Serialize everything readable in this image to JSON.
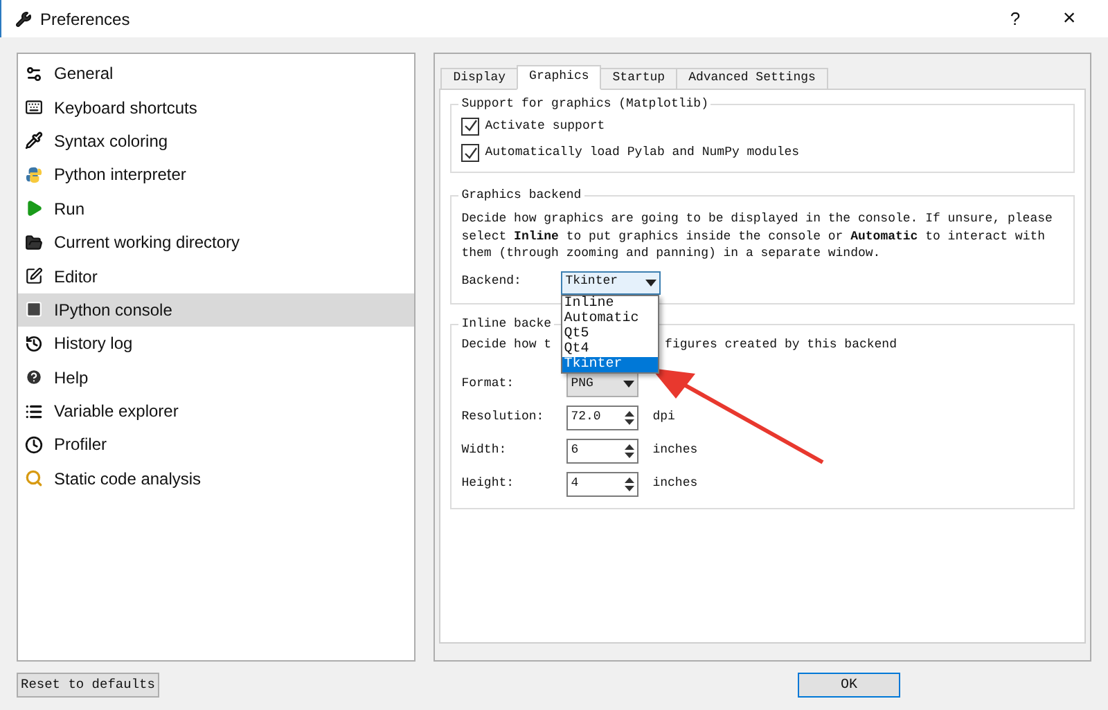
{
  "window": {
    "title": "Preferences",
    "help": "?",
    "close": "×"
  },
  "sidebar": {
    "items": [
      {
        "label": "General",
        "selected": false
      },
      {
        "label": "Keyboard shortcuts",
        "selected": false
      },
      {
        "label": "Syntax coloring",
        "selected": false
      },
      {
        "label": "Python interpreter",
        "selected": false
      },
      {
        "label": "Run",
        "selected": false
      },
      {
        "label": "Current working directory",
        "selected": false
      },
      {
        "label": "Editor",
        "selected": false
      },
      {
        "label": "IPython console",
        "selected": true
      },
      {
        "label": "History log",
        "selected": false
      },
      {
        "label": "Help",
        "selected": false
      },
      {
        "label": "Variable explorer",
        "selected": false
      },
      {
        "label": "Profiler",
        "selected": false
      },
      {
        "label": "Static code analysis",
        "selected": false
      }
    ]
  },
  "tabs": [
    {
      "label": "Display",
      "selected": false
    },
    {
      "label": "Graphics",
      "selected": true
    },
    {
      "label": "Startup",
      "selected": false
    },
    {
      "label": "Advanced Settings",
      "selected": false
    }
  ],
  "matplotlib_group": {
    "title": "Support for graphics (Matplotlib)",
    "checkboxes": [
      {
        "label": "Activate support",
        "checked": true
      },
      {
        "label": "Automatically load Pylab and NumPy modules",
        "checked": true
      }
    ]
  },
  "backend_group": {
    "title": "Graphics backend",
    "description": "Decide how graphics are going to be displayed in the console. If unsure, please select **Inline** to put graphics inside the console or **Automatic** to interact with them (through zooming and panning) in a separate window.",
    "label": "Backend:",
    "value": "Tkinter",
    "options": [
      {
        "label": "Inline",
        "selected": false
      },
      {
        "label": "Automatic",
        "selected": false
      },
      {
        "label": "Qt5",
        "selected": false
      },
      {
        "label": "Qt4",
        "selected": false
      },
      {
        "label": "Tkinter",
        "selected": true
      }
    ]
  },
  "inline_group": {
    "title": "Inline backe",
    "description_start": "Decide how t",
    "description_end": "figures created by this backend",
    "fields": [
      {
        "kind": "combo",
        "label": "Format:",
        "value": "PNG"
      },
      {
        "kind": "spin",
        "label": "Resolution:",
        "value": "72.0",
        "unit": "dpi"
      },
      {
        "kind": "spin",
        "label": "Width:",
        "value": "6",
        "unit": "inches"
      },
      {
        "kind": "spin",
        "label": "Height:",
        "value": "4",
        "unit": "inches"
      }
    ]
  },
  "footer": {
    "reset": "Reset to defaults",
    "ok": "OK"
  }
}
